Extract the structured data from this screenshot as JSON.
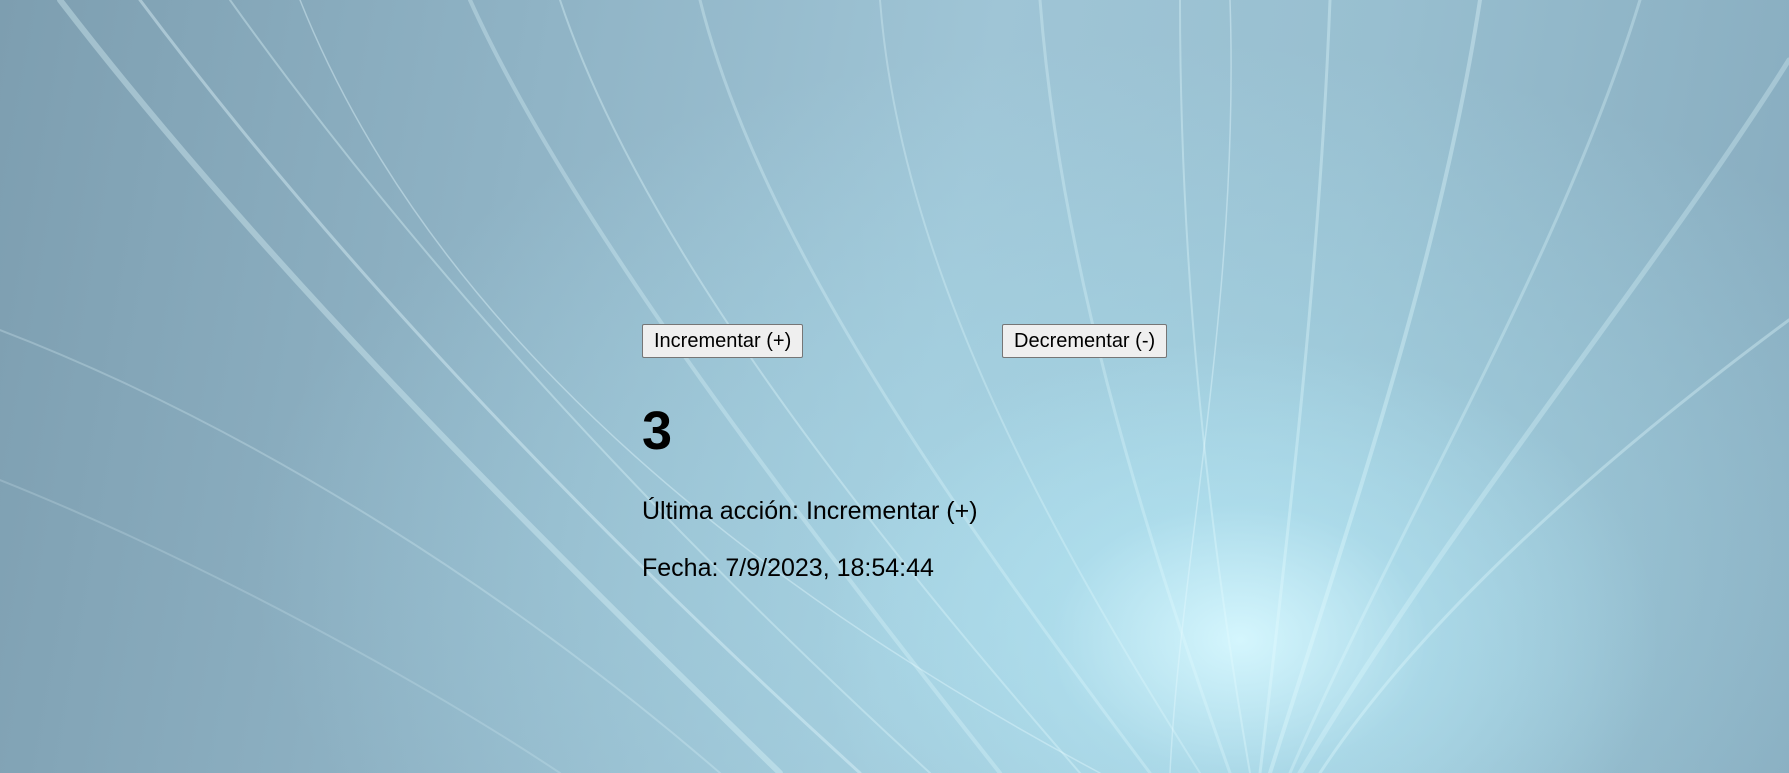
{
  "buttons": {
    "increment_label": "Incrementar (+)",
    "decrement_label": "Decrementar (-)"
  },
  "counter": {
    "value": "3"
  },
  "status": {
    "last_action_label": "Última acción:",
    "last_action_value": "Incrementar (+)",
    "date_label": "Fecha:",
    "date_value": "7/9/2023, 18:54:44"
  },
  "colors": {
    "background_base": "#8fb3c5",
    "background_glow": "#d7f8ff",
    "text": "#000000",
    "button_bg": "#efefef",
    "button_border": "#767676"
  }
}
